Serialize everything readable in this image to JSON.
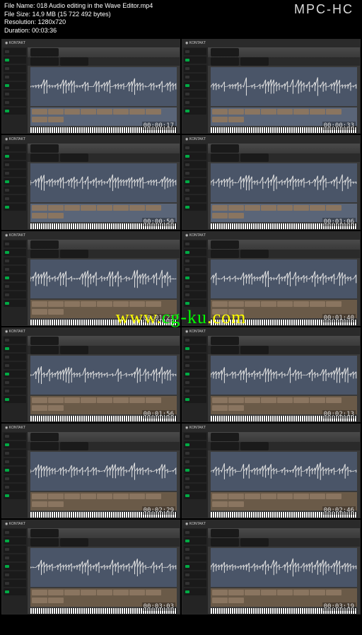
{
  "app_logo": "MPC-HC",
  "info": {
    "filename_label": "File Name:",
    "filename": "018 Audio editing in the Wave Editor.mp4",
    "filesize_label": "File Size:",
    "filesize": "14,9 MB (15 722 492 bytes)",
    "resolution_label": "Resolution:",
    "resolution": "1280x720",
    "duration_label": "Duration:",
    "duration": "00:03:36"
  },
  "plugin_name": "KONTAKT",
  "thumbnails": [
    {
      "timecode": "00:00:17",
      "panel": "blue"
    },
    {
      "timecode": "00:00:33",
      "panel": "blue"
    },
    {
      "timecode": "00:00:50",
      "panel": "blue"
    },
    {
      "timecode": "00:01:06",
      "panel": "blue"
    },
    {
      "timecode": "00:01:23",
      "panel": "brown"
    },
    {
      "timecode": "00:01:40",
      "panel": "brown"
    },
    {
      "timecode": "00:01:56",
      "panel": "brown"
    },
    {
      "timecode": "00:02:13",
      "panel": "brown"
    },
    {
      "timecode": "00:02:29",
      "panel": "brown"
    },
    {
      "timecode": "00:02:46",
      "panel": "brown"
    },
    {
      "timecode": "00:03:03",
      "panel": "brown"
    },
    {
      "timecode": "00:03:19",
      "panel": "brown"
    }
  ],
  "watermark": {
    "prefix": "www.",
    "main": "cg-ku",
    "suffix": ".com"
  }
}
